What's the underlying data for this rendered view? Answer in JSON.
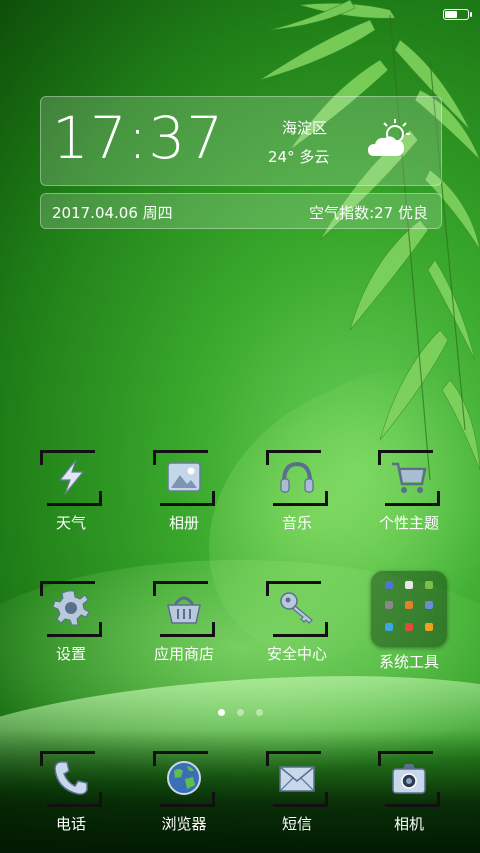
{
  "status_bar": {
    "battery_level": 0.55
  },
  "clock_widget": {
    "time": "17:37",
    "location": "海淀区",
    "temperature": "24°",
    "condition": "多云",
    "weather_icon": "partly-cloudy-icon",
    "date": "2017.04.06",
    "weekday": "周四",
    "aqi_text": "空气指数:27 优良"
  },
  "apps_row1": [
    {
      "label": "天气",
      "icon": "lightning-icon"
    },
    {
      "label": "相册",
      "icon": "picture-icon"
    },
    {
      "label": "音乐",
      "icon": "headphones-icon"
    },
    {
      "label": "个性主题",
      "icon": "cart-icon"
    }
  ],
  "apps_row2": [
    {
      "label": "设置",
      "icon": "gear-icon"
    },
    {
      "label": "应用商店",
      "icon": "shopping-basket-icon"
    },
    {
      "label": "安全中心",
      "icon": "key-icon"
    },
    {
      "label": "系统工具",
      "icon": "folder-icon"
    }
  ],
  "page_indicator": {
    "pages": 3,
    "active": 0
  },
  "dock": [
    {
      "label": "电话",
      "icon": "phone-icon"
    },
    {
      "label": "浏览器",
      "icon": "globe-icon"
    },
    {
      "label": "短信",
      "icon": "envelope-icon"
    },
    {
      "label": "相机",
      "icon": "camera-icon"
    }
  ],
  "colors": {
    "accent": "#3aa82c",
    "text": "#ffffff",
    "frame": "#111111"
  }
}
